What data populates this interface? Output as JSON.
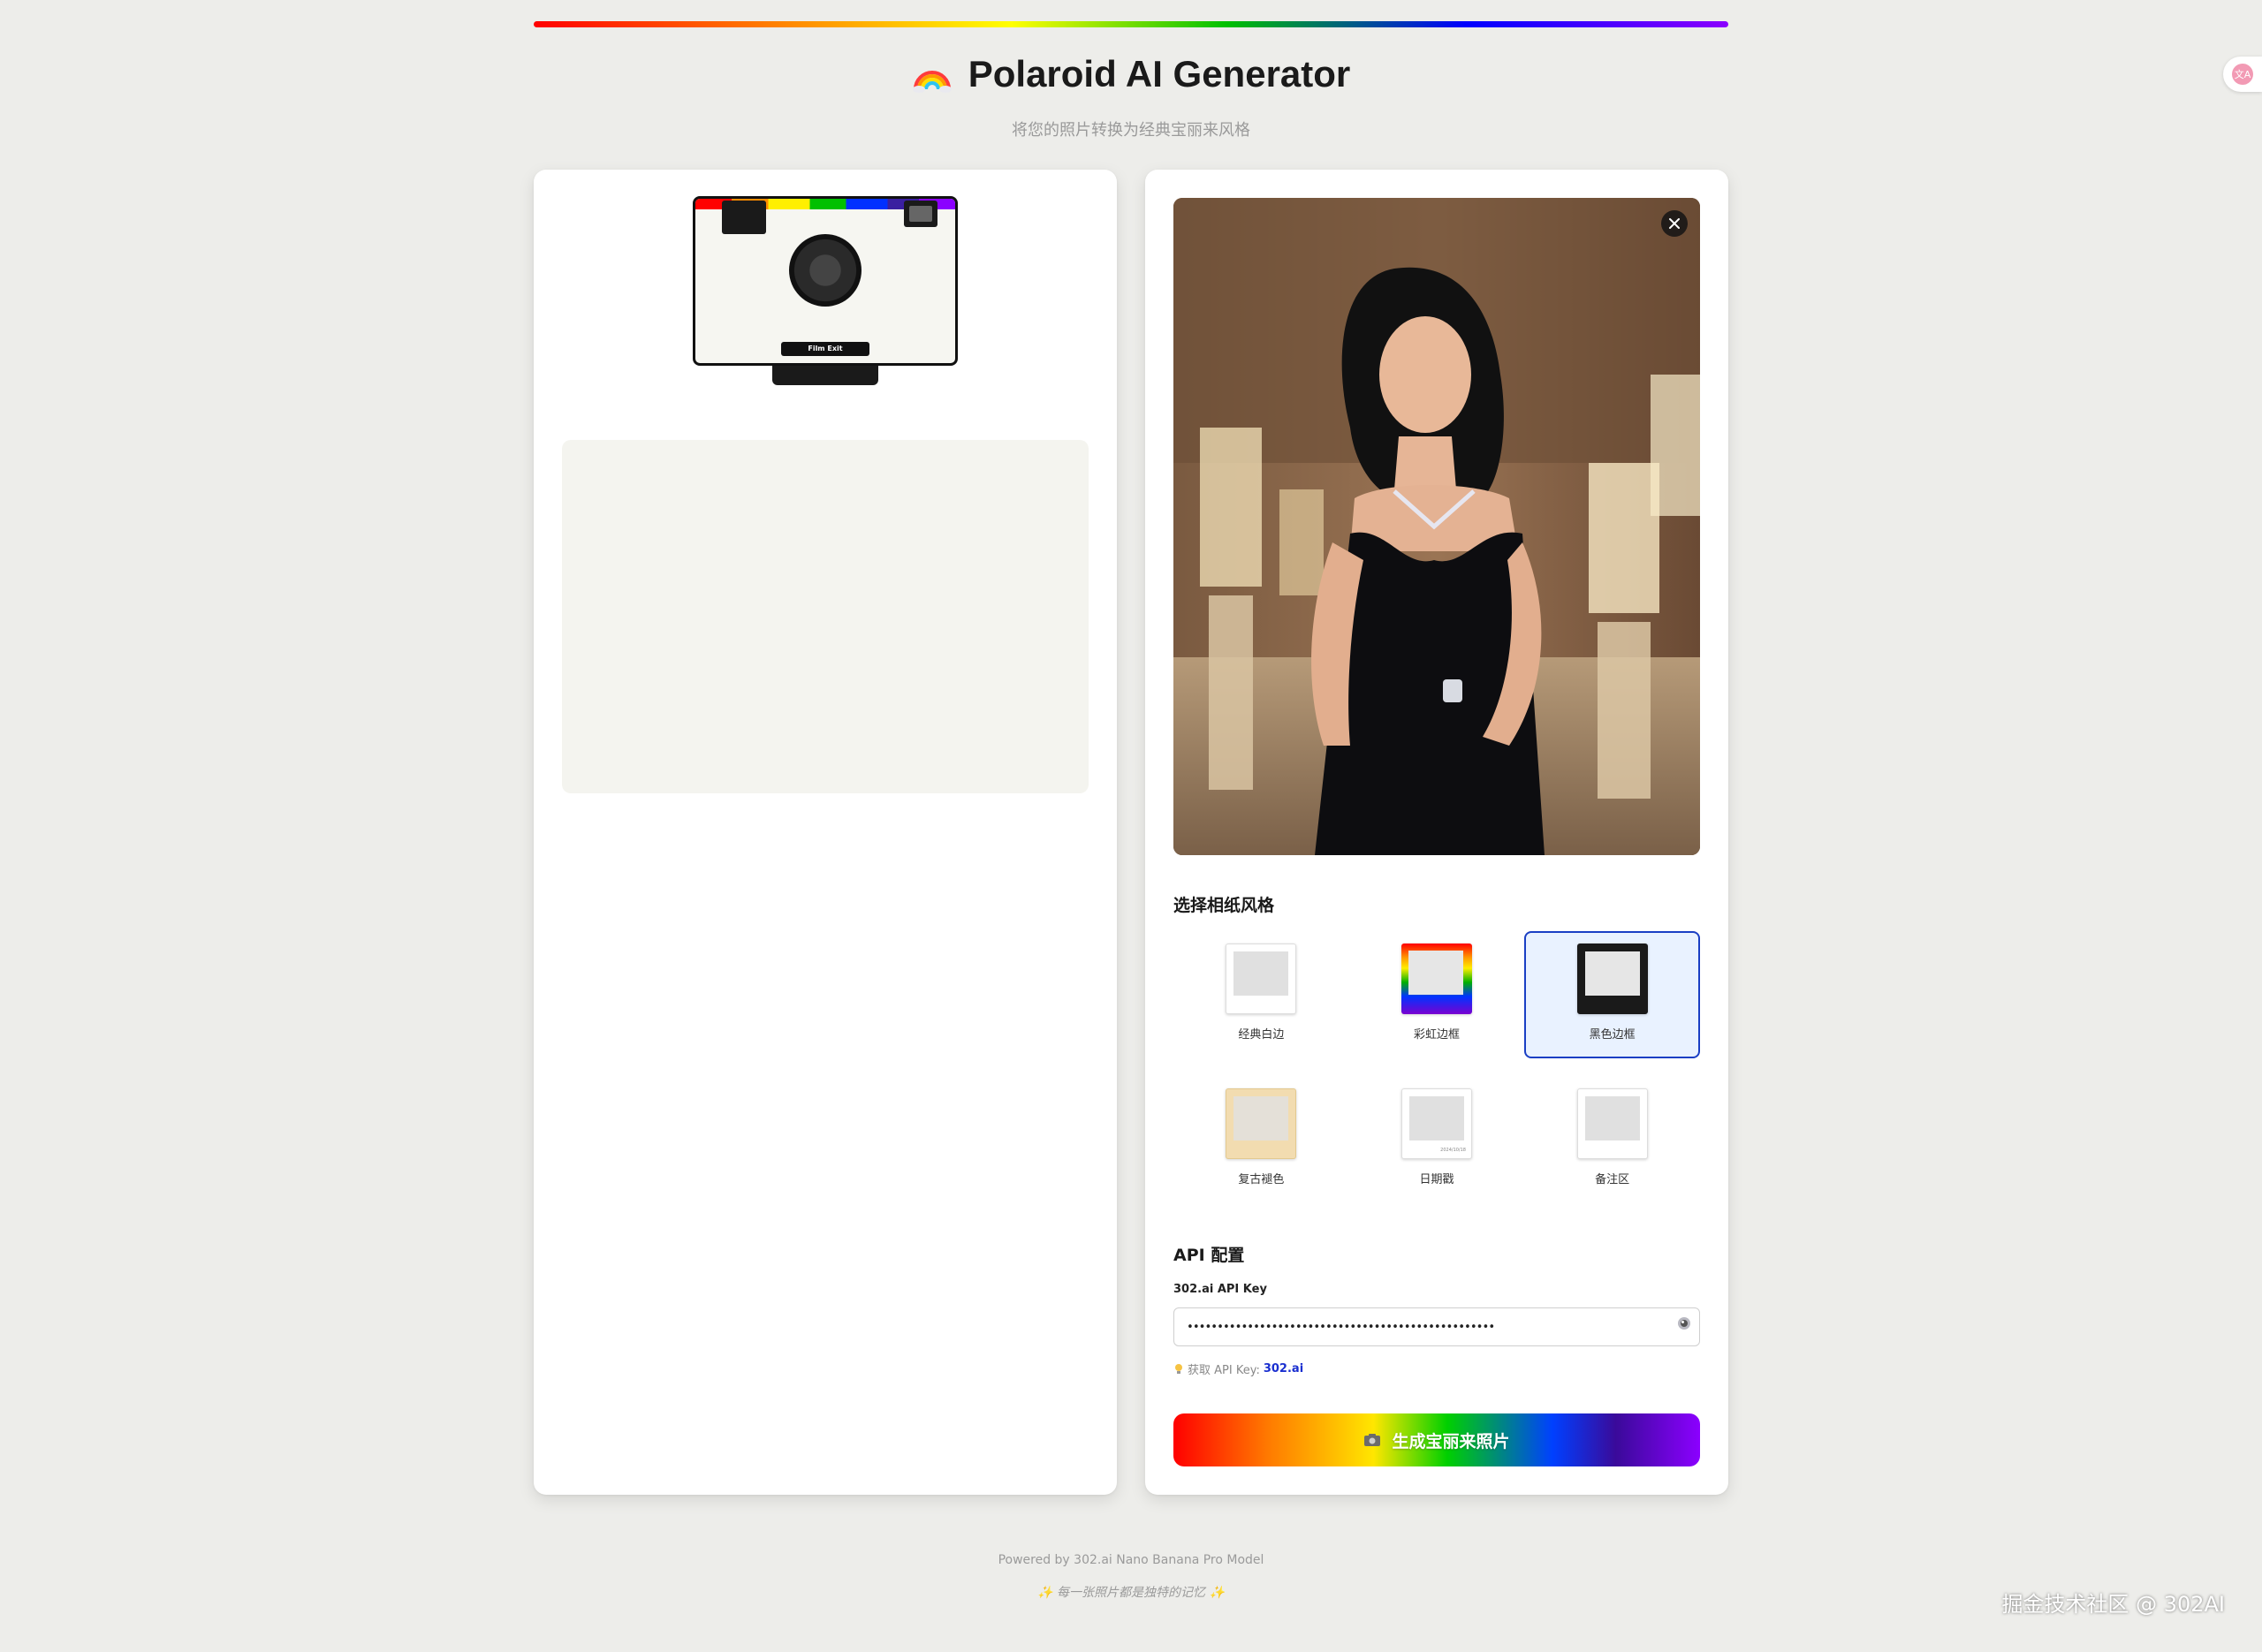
{
  "header": {
    "title": "Polaroid AI Generator",
    "subtitle": "将您的照片转换为经典宝丽来风格",
    "emoji_icon": "rainbow-icon"
  },
  "camera": {
    "film_exit_label": "Film Exit"
  },
  "style_section": {
    "title": "选择相纸风格",
    "selected": "黑色边框",
    "options": [
      {
        "label": "经典白边"
      },
      {
        "label": "彩虹边框"
      },
      {
        "label": "黑色边框"
      },
      {
        "label": "复古褪色"
      },
      {
        "label": "日期戳",
        "stamp": "2024/10/18"
      },
      {
        "label": "备注区"
      }
    ]
  },
  "api_section": {
    "title": "API 配置",
    "field_label": "302.ai API Key",
    "value": "•••••••••••••••••••••••••••••••••••••••••••••••••••",
    "hint_prefix": "获取 API Key:",
    "hint_link": "302.ai"
  },
  "generate_button": {
    "label": "生成宝丽来照片"
  },
  "footer": {
    "powered_by": "Powered by 302.ai Nano Banana Pro Model",
    "tagline": "✨ 每一张照片都是独特的记忆 ✨"
  },
  "watermark": "掘金技术社区 @ 302AI",
  "colors": {
    "accent_blue": "#1a3fc4",
    "panel_bg": "#ffffff",
    "page_bg": "#ededea"
  }
}
